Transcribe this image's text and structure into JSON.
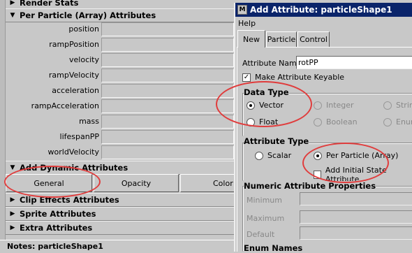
{
  "editor": {
    "render_stats": "Render Stats",
    "per_particle_title": "Per Particle (Array) Attributes",
    "attrs": [
      "position",
      "rampPosition",
      "velocity",
      "rampVelocity",
      "acceleration",
      "rampAcceleration",
      "mass",
      "lifespanPP",
      "worldVelocity"
    ],
    "add_dynamic_title": "Add Dynamic Attributes",
    "buttons": {
      "general": "General",
      "opacity": "Opacity",
      "color": "Color"
    },
    "clip_effects": "Clip Effects Attributes",
    "sprite": "Sprite Attributes",
    "extra": "Extra Attributes",
    "notes": "Notes: particleShape1"
  },
  "dialog": {
    "title": "Add Attribute: particleShape1",
    "menu_help": "Help",
    "tabs": [
      "New",
      "Particle",
      "Control"
    ],
    "attr_name_label": "Attribute Name",
    "attr_name_value": "rotPP",
    "keyable_label": "Make Attribute Keyable",
    "data_type": {
      "title": "Data Type",
      "vector": "Vector",
      "float": "Float",
      "integer": "Integer",
      "boolean": "Boolean",
      "string": "String",
      "enum": "Enum",
      "selected": "Vector"
    },
    "attr_type": {
      "title": "Attribute Type",
      "scalar": "Scalar",
      "per_particle": "Per Particle (Array)",
      "initial_state": "Add Initial State Attribute",
      "selected": "Per Particle (Array)"
    },
    "numeric": {
      "title": "Numeric Attribute Properties",
      "minimum": "Minimum",
      "maximum": "Maximum",
      "default": "Default"
    },
    "enum_names": "Enum Names"
  },
  "colors": {
    "title_bar": "#0a246a",
    "panel": "#c8c8c8",
    "highlight": "#e03c3c"
  }
}
